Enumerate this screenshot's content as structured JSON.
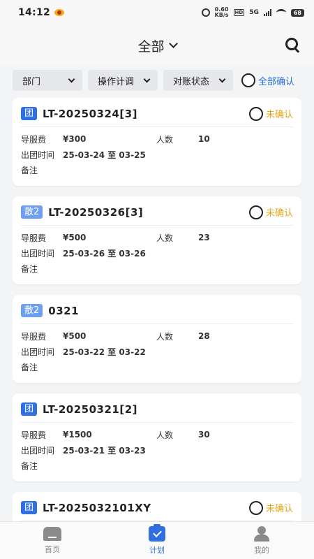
{
  "status_bar": {
    "time": "14:12",
    "net_speed_value": "0.60",
    "net_speed_unit": "KB/s",
    "hd": "HD",
    "network": "5G",
    "battery": "68"
  },
  "header": {
    "title": "全部"
  },
  "filters": {
    "department": "部门",
    "operator": "操作计调",
    "reconcile": "对账状态",
    "confirm_all": "全部确认"
  },
  "labels": {
    "fee": "导服费",
    "people": "人数",
    "depart": "出团时间",
    "remark": "备注"
  },
  "cards": [
    {
      "tag": "团",
      "title": "LT-20250324[3]",
      "status": "未确认",
      "fee": "¥300",
      "people": "10",
      "depart": "25-03-24 至 03-25"
    },
    {
      "tag": "散2",
      "title": "LT-20250326[3]",
      "status": "未确认",
      "fee": "¥500",
      "people": "23",
      "depart": "25-03-26 至 03-26"
    },
    {
      "tag": "散2",
      "title": "0321",
      "status": "",
      "fee": "¥500",
      "people": "28",
      "depart": "25-03-22 至 03-22"
    },
    {
      "tag": "团",
      "title": "LT-20250321[2]",
      "status": "",
      "fee": "¥1500",
      "people": "30",
      "depart": "25-03-21 至 03-23"
    },
    {
      "tag": "团",
      "title": "LT-2025032101XY",
      "status": "未确认",
      "fee": "",
      "people": "",
      "depart": ""
    }
  ],
  "tabbar": {
    "home": "首页",
    "plan": "计划",
    "mine": "我的"
  },
  "colors": {
    "accent": "#2f6fe0",
    "tag_san": "#6f9ff0",
    "unconfirmed": "#e6a517"
  }
}
